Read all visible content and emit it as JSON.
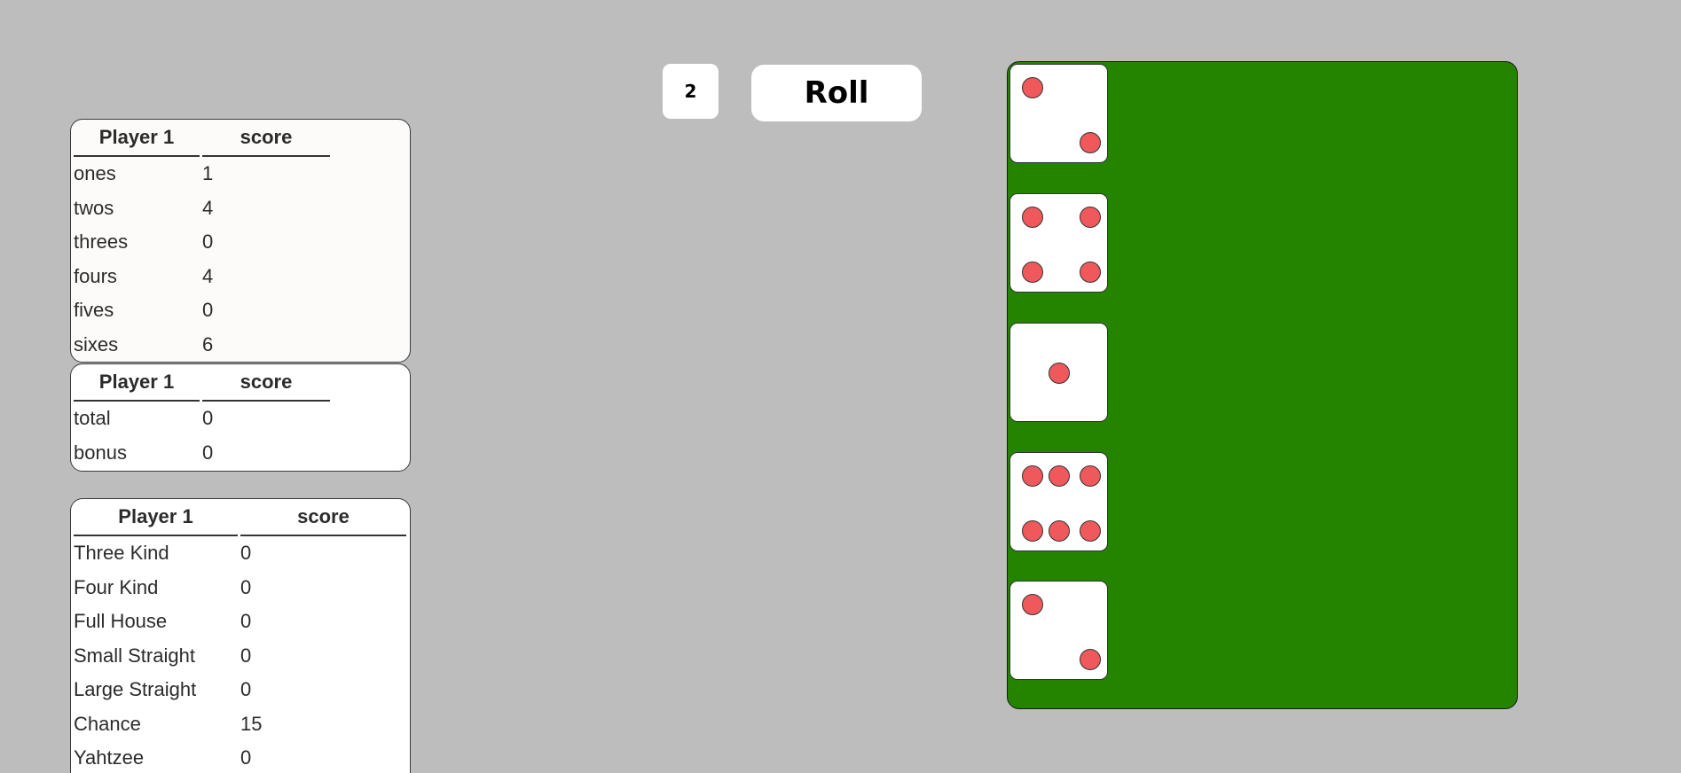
{
  "upper": {
    "header_player": "Player 1",
    "header_score": "score",
    "rows": [
      {
        "label": "ones",
        "value": "1"
      },
      {
        "label": "twos",
        "value": "4"
      },
      {
        "label": "threes",
        "value": "0"
      },
      {
        "label": "fours",
        "value": "4"
      },
      {
        "label": "fives",
        "value": "0"
      },
      {
        "label": "sixes",
        "value": "6"
      }
    ]
  },
  "totals": {
    "header_player": "Player 1",
    "header_score": "score",
    "rows": [
      {
        "label": "total",
        "value": "0"
      },
      {
        "label": "bonus",
        "value": "0"
      }
    ]
  },
  "lower": {
    "header_player": "Player 1",
    "header_score": "score",
    "rows": [
      {
        "label": "Three Kind",
        "value": "0"
      },
      {
        "label": "Four Kind",
        "value": "0"
      },
      {
        "label": "Full House",
        "value": "0"
      },
      {
        "label": "Small Straight",
        "value": "0"
      },
      {
        "label": "Large Straight",
        "value": "0"
      },
      {
        "label": "Chance",
        "value": "15"
      },
      {
        "label": "Yahtzee",
        "value": "0"
      }
    ]
  },
  "controls": {
    "roll_count": "2",
    "roll_label": "Roll"
  },
  "dice": [
    2,
    4,
    1,
    6,
    2
  ],
  "colors": {
    "background": "#bdbdbd",
    "tray": "#248400",
    "pip": "#f0595c",
    "die_face": "#ffffff"
  }
}
